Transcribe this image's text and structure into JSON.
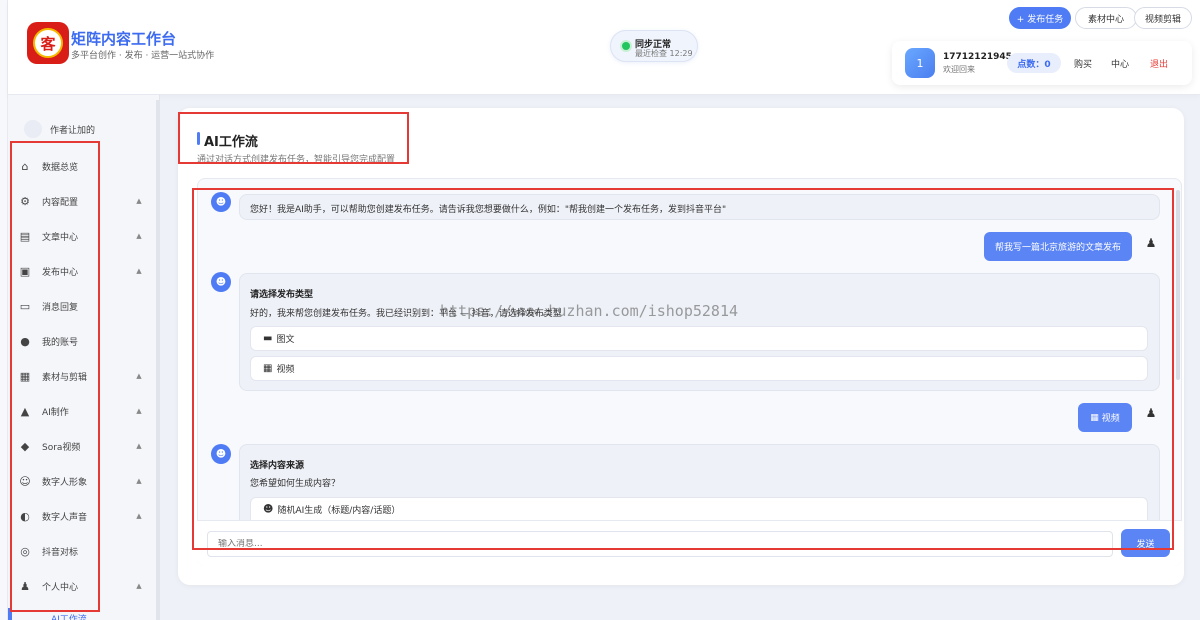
{
  "header": {
    "app_title": "矩阵内容工作台",
    "app_subtitle": "多平台创作 · 发布 · 运营一站式协作",
    "logo_text": "客",
    "sync": {
      "title": "同步正常",
      "time": "最近检查 12:29"
    },
    "actions": {
      "publish": "+ 发布任务",
      "material": "素材中心",
      "video": "视频剪辑"
    },
    "user": {
      "avatar_text": "1",
      "phone": "17712121945",
      "welcome": "欢迎回来",
      "points_label": "点数：0",
      "buy": "购买",
      "center": "中心",
      "logout": "退出"
    }
  },
  "sidebar": {
    "top_item": "作者让加的",
    "items": [
      {
        "icon": "home-icon",
        "glyph": "⌂",
        "label": "数据总览",
        "arrow": ""
      },
      {
        "icon": "gear-icon",
        "glyph": "⚙",
        "label": "内容配置",
        "arrow": "▲"
      },
      {
        "icon": "document-icon",
        "glyph": "▤",
        "label": "文章中心",
        "arrow": "▲"
      },
      {
        "icon": "package-icon",
        "glyph": "▣",
        "label": "发布中心",
        "arrow": "▲"
      },
      {
        "icon": "chat-icon",
        "glyph": "▭",
        "label": "消息回复",
        "arrow": ""
      },
      {
        "icon": "person-icon",
        "glyph": "●",
        "label": "我的账号",
        "arrow": ""
      },
      {
        "icon": "film-icon",
        "glyph": "▦",
        "label": "素材与剪辑",
        "arrow": "▲"
      },
      {
        "icon": "ai-icon",
        "glyph": "▲",
        "label": "AI制作",
        "arrow": "▲"
      },
      {
        "icon": "video-icon",
        "glyph": "◆",
        "label": "Sora视频",
        "arrow": "▲"
      },
      {
        "icon": "digital-human-icon",
        "glyph": "☺",
        "label": "数字人形象",
        "arrow": "▲"
      },
      {
        "icon": "voice-icon",
        "glyph": "◐",
        "label": "数字人声音",
        "arrow": "▲"
      },
      {
        "icon": "target-icon",
        "glyph": "◎",
        "label": "抖音对标",
        "arrow": ""
      },
      {
        "icon": "user-center-icon",
        "glyph": "♟",
        "label": "个人中心",
        "arrow": "▲"
      }
    ],
    "active_label": "AI工作流"
  },
  "main": {
    "title": "AI工作流",
    "subtitle": "通过对话方式创建发布任务，智能引导您完成配置"
  },
  "chat": {
    "greeting": "您好！我是AI助手，可以帮助您创建发布任务。请告诉我您想要做什么，例如：\"帮我创建一个发布任务，发到抖音平台\"",
    "user_msg_1": "帮我写一篇北京旅游的文章发布",
    "publish_type": {
      "title": "请选择发布类型",
      "text": "好的，我来帮您创建发布任务。我已经识别到：平台 — 抖音，请选择发布类型",
      "options": [
        "图文",
        "视频"
      ]
    },
    "user_msg_2": "视频",
    "content_source": {
      "title": "选择内容来源",
      "text": "您希望如何生成内容？",
      "option": "随机AI生成（标题/内容/话题）"
    },
    "input_placeholder": "输入消息...",
    "send_label": "发送"
  },
  "watermark": "https://www.huzhan.com/ishop52814",
  "colors": {
    "accent": "#4f7cf5",
    "annotation": "#e53935",
    "sync_ok": "#22c55e"
  }
}
